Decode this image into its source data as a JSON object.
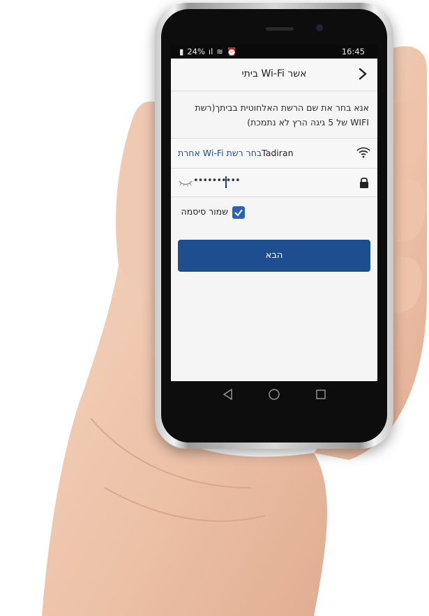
{
  "status": {
    "battery": "24%",
    "time": "16:45"
  },
  "header": {
    "title": "אשר Wi-Fi ביתי"
  },
  "instruction": {
    "line1": "אנא בחר את שם הרשת האלחוטית בביתך(רשת",
    "line2": "WIFI של 5 גיגה הרץ לא נתמכת)"
  },
  "network": {
    "name": "Tadiran",
    "other_label": "בחר רשת Wi-Fi אחרת"
  },
  "password": {
    "masked_value": "••••••••••"
  },
  "remember": {
    "label": "שמור סיסמה",
    "checked": true
  },
  "next_button": {
    "label": "הבא"
  },
  "colors": {
    "accent": "#1f4e8f",
    "checkbox": "#2c62b0"
  }
}
